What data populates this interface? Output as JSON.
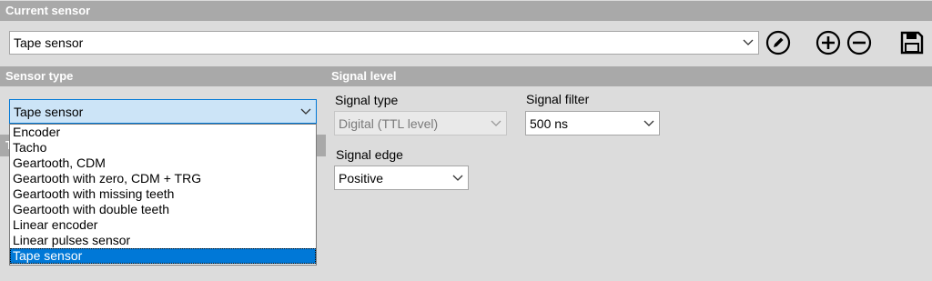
{
  "current_sensor": {
    "header": "Current sensor",
    "selected": "Tape sensor",
    "actions": {
      "edit_icon": "pencil-circle-icon",
      "add_icon": "plus-circle-icon",
      "remove_icon": "minus-circle-icon",
      "save_icon": "floppy-disk-icon"
    }
  },
  "sensor_type": {
    "header": "Sensor type",
    "selected": "Tape sensor",
    "options": [
      "Encoder",
      "Tacho",
      "Geartooth, CDM",
      "Geartooth with zero, CDM + TRG",
      "Geartooth with missing teeth",
      "Geartooth with double teeth",
      "Linear encoder",
      "Linear pulses sensor",
      "Tape sensor"
    ],
    "hidden_header_fragment": "T"
  },
  "signal_level": {
    "header": "Signal level",
    "signal_type": {
      "label": "Signal type",
      "value": "Digital (TTL level)"
    },
    "signal_filter": {
      "label": "Signal filter",
      "value": "500 ns"
    },
    "signal_edge": {
      "label": "Signal edge",
      "value": "Positive"
    }
  },
  "colors": {
    "section_header_bg": "#a9a9a9",
    "panel_bg": "#dcdcdc",
    "selection_blue": "#0078d7",
    "open_combo_bg": "#cce4f7"
  }
}
